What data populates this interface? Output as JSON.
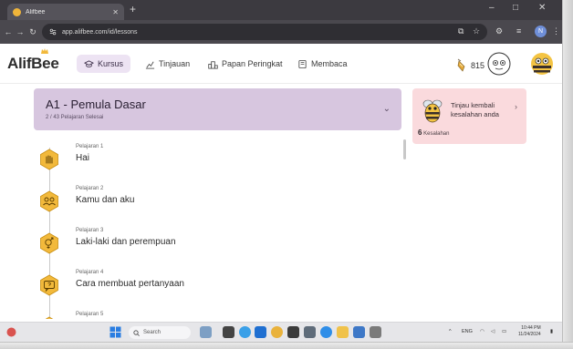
{
  "browser": {
    "tab_title": "Alifbee",
    "new_tab_symbol": "+",
    "url": "app.alifbee.com/id/lessons",
    "win_min": "–",
    "win_max": "□",
    "win_close": "✕",
    "profile_initial": "N"
  },
  "app": {
    "logo": "AlifBee",
    "nav": [
      {
        "label": "Kursus",
        "icon": "graduation-cap-icon",
        "active": true
      },
      {
        "label": "Tinjauan",
        "icon": "chart-icon",
        "active": false
      },
      {
        "label": "Papan Peringkat",
        "icon": "podium-icon",
        "active": false
      },
      {
        "label": "Membaca",
        "icon": "book-icon",
        "active": false
      }
    ],
    "stat_value": "815"
  },
  "course": {
    "title": "A1 - Pemula Dasar",
    "progress": "2 / 43 Pelajaran Selesai",
    "progress_fraction": 0.0465
  },
  "lessons": [
    {
      "number": "Pelajaran 1",
      "name": "Hai",
      "icon": "greeting-icon"
    },
    {
      "number": "Pelajaran 2",
      "name": "Kamu dan aku",
      "icon": "people-icon"
    },
    {
      "number": "Pelajaran 3",
      "name": "Laki-laki dan perempuan",
      "icon": "gender-icon"
    },
    {
      "number": "Pelajaran 4",
      "name": "Cara membuat pertanyaan",
      "icon": "question-chat-icon"
    },
    {
      "number": "Pelajaran 5",
      "name": "",
      "icon": "lesson-icon"
    }
  ],
  "review": {
    "title": "Tinjau kembali kesalahan anda",
    "count": "6",
    "count_label": "Kesalahan"
  },
  "taskbar": {
    "search_placeholder": "Search",
    "lang": "ENG",
    "time": "10:44 PM",
    "date": "11/24/2024"
  },
  "colors": {
    "banner": "#d7c6df",
    "nav_active": "#ede3f3",
    "review_card": "#fadadd",
    "lesson_badge": "#f2b93b"
  }
}
